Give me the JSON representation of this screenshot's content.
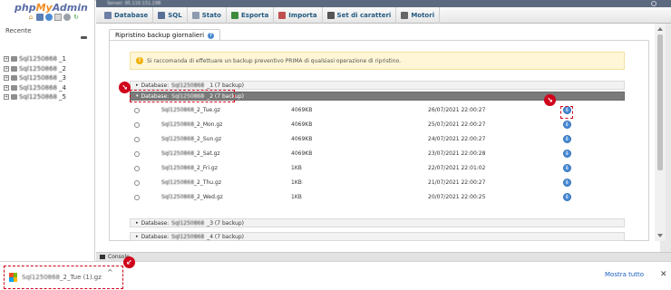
{
  "nav": {
    "logo": {
      "php": "php",
      "my": "My",
      "admin": "Admin"
    },
    "recent_label": "Recente",
    "databases": [
      {
        "name": "Sql1250868",
        "num": "_1"
      },
      {
        "name": "Sql1250868",
        "num": "_2"
      },
      {
        "name": "Sql1250868",
        "num": "_3"
      },
      {
        "name": "Sql1250868",
        "num": "_4"
      },
      {
        "name": "Sql1250868",
        "num": "_5"
      }
    ]
  },
  "topbar": {
    "server": "Server: 95.110.151.198"
  },
  "tabs": [
    {
      "label": "Database",
      "icon": "database-icon",
      "color": "#6b7fa5"
    },
    {
      "label": "SQL",
      "icon": "sql-icon",
      "color": "#5a6f95"
    },
    {
      "label": "Stato",
      "icon": "status-icon",
      "color": "#8e9ab0"
    },
    {
      "label": "Esporta",
      "icon": "export-icon",
      "color": "#3c8d3c"
    },
    {
      "label": "Importa",
      "icon": "import-icon",
      "color": "#c05050"
    },
    {
      "label": "Set di caratteri",
      "icon": "charset-icon",
      "color": "#555555"
    },
    {
      "label": "Motori",
      "icon": "engines-icon",
      "color": "#666666"
    }
  ],
  "panel": {
    "title": "Ripristino backup giornalieri",
    "warning": "Si raccomanda di effettuare un backup preventivo PRIMA di qualsiasi operazione di ripristino.",
    "db_prefix": "Database:",
    "groups": [
      {
        "name": "Sql1250868",
        "suffix": "_1 (7 backup)"
      },
      {
        "name": "Sql1250868",
        "suffix": "_2 (7 backup)"
      },
      {
        "name": "Sql1250868",
        "suffix": "_3 (7 backup)"
      },
      {
        "name": "Sql1250868",
        "suffix": "_4 (7 backup)"
      }
    ],
    "rows": [
      {
        "base": "Sql1250868",
        "file": "_2_Tue.gz",
        "size": "4069KB",
        "date": "26/07/2021 22:00:27"
      },
      {
        "base": "Sql1250868",
        "file": "_2_Mon.gz",
        "size": "4069KB",
        "date": "25/07/2021 22:00:27"
      },
      {
        "base": "Sql1250868",
        "file": "_2_Sun.gz",
        "size": "4069KB",
        "date": "24/07/2021 22:00:27"
      },
      {
        "base": "Sql1250868",
        "file": "_2_Sat.gz",
        "size": "4069KB",
        "date": "23/07/2021 22:00:28"
      },
      {
        "base": "Sql1250868",
        "file": "_2_Fri.gz",
        "size": "1KB",
        "date": "22/07/2021 22:01:02"
      },
      {
        "base": "Sql1250868",
        "file": "_2_Thu.gz",
        "size": "1KB",
        "date": "21/07/2021 22:00:27"
      },
      {
        "base": "Sql1250868",
        "file": "_2_Wed.gz",
        "size": "1KB",
        "date": "20/07/2021 22:00:25"
      }
    ]
  },
  "console": {
    "label": "Console"
  },
  "download_bar": {
    "file_base": "Sql1250868",
    "file_suffix": "_2_Tue (1).gz",
    "show_all": "Mostra tutto",
    "close": "✕",
    "chevron": "^"
  },
  "colors": {
    "accent_red": "#d0021b",
    "link_blue": "#1a5ebf"
  }
}
